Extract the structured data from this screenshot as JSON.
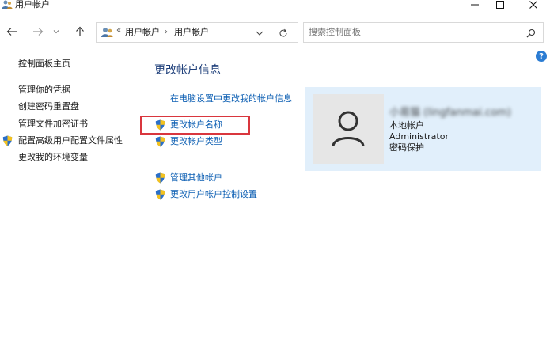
{
  "window": {
    "title": "用户帐户"
  },
  "nav": {
    "breadcrumbs": [
      "用户帐户",
      "用户帐户"
    ],
    "search_placeholder": "搜索控制面板"
  },
  "help": {
    "label": "?"
  },
  "sidebar": {
    "home": "控制面板主页",
    "items": [
      {
        "label": "管理你的凭据",
        "shield": false
      },
      {
        "label": "创建密码重置盘",
        "shield": false
      },
      {
        "label": "管理文件加密证书",
        "shield": false
      },
      {
        "label": "配置高级用户配置文件属性",
        "shield": true
      },
      {
        "label": "更改我的环境变量",
        "shield": false
      }
    ]
  },
  "main": {
    "title": "更改帐户信息",
    "pc_settings_link": "在电脑设置中更改我的帐户信息",
    "actions": [
      {
        "label": "更改帐户名称",
        "shield": true,
        "highlighted": true
      },
      {
        "label": "更改帐户类型",
        "shield": true,
        "highlighted": false
      }
    ],
    "other_actions": [
      {
        "label": "管理其他帐户",
        "shield": true
      },
      {
        "label": "更改用户帐户控制设置",
        "shield": true
      }
    ]
  },
  "account": {
    "display_name": "小易猫 (lingfanmai.com)",
    "type": "本地帐户",
    "role": "Administrator",
    "password_status": "密码保护"
  },
  "colors": {
    "link": "#0d5fb3",
    "title": "#1e3f7a",
    "panel": "#e1effb",
    "highlight_box": "#d9363e"
  },
  "icons": {
    "title": "users-icon",
    "minimize": "minimize-icon",
    "maximize": "maximize-icon",
    "close": "close-icon",
    "back": "arrow-left-icon",
    "forward": "arrow-right-icon",
    "recent": "chevron-down-icon",
    "up": "arrow-up-icon",
    "address": "control-panel-icon",
    "dropdown": "chevron-down-icon",
    "refresh": "refresh-icon",
    "search": "search-icon",
    "shield": "uac-shield-icon",
    "avatar": "user-avatar-icon"
  }
}
